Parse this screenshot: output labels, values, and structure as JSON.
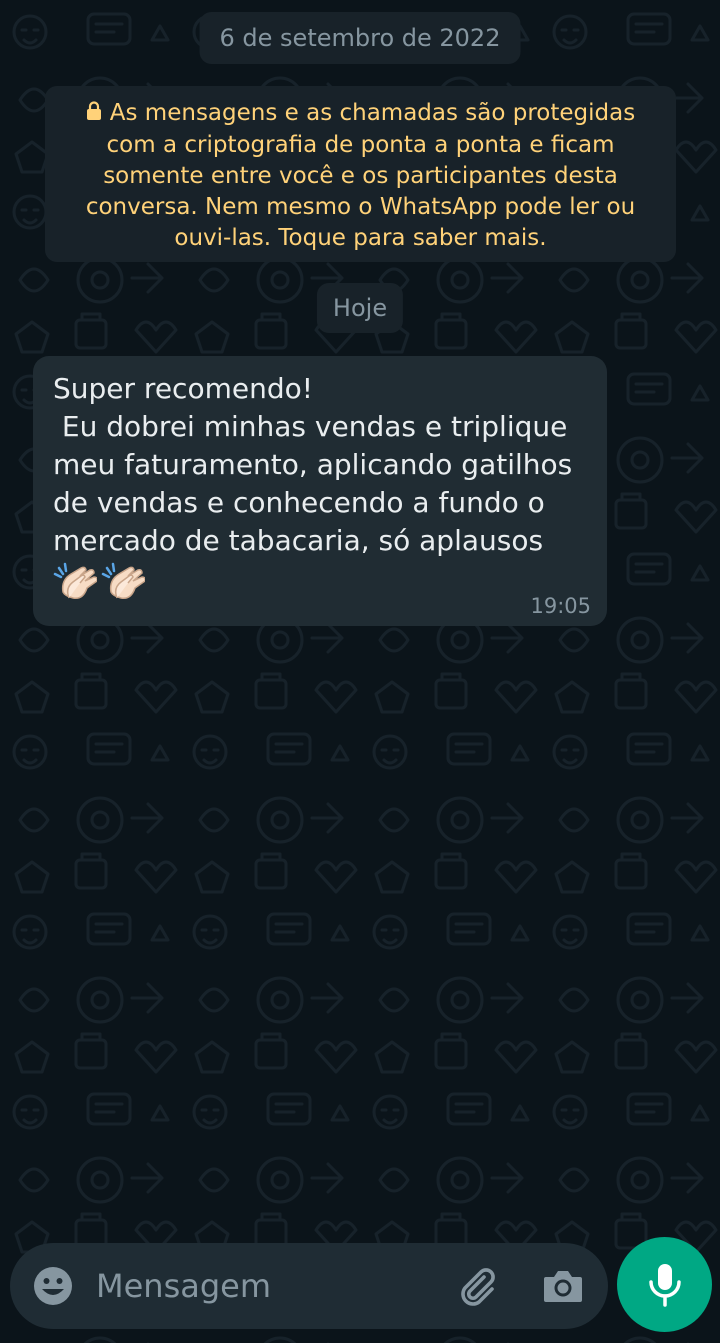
{
  "chat": {
    "date_chip": "6 de setembro de 2022",
    "encryption_notice": "As mensagens e as chamadas são protegidas com a criptografia de ponta a ponta e ficam somente entre você e os participantes desta conversa. Nem mesmo o WhatsApp pode ler ou ouvi-las. Toque para saber mais.",
    "today_chip": "Hoje",
    "messages": [
      {
        "direction": "incoming",
        "text": "Super recomendo!\n Eu dobrei minhas vendas e triplique meu faturamento, aplicando gatilhos de vendas e conhecendo a fundo o mercado de tabacaria, só aplausos",
        "emojis": [
          "👏🏻",
          "👏🏻"
        ],
        "time": "19:05"
      }
    ]
  },
  "composer": {
    "placeholder": "Mensagem",
    "icons": [
      "emoji-icon",
      "attach-icon",
      "camera-icon",
      "mic-icon"
    ]
  },
  "colors": {
    "background": "#0b141a",
    "bubble_incoming": "#202c33",
    "notice_text": "#ffd279",
    "accent": "#00a884"
  }
}
